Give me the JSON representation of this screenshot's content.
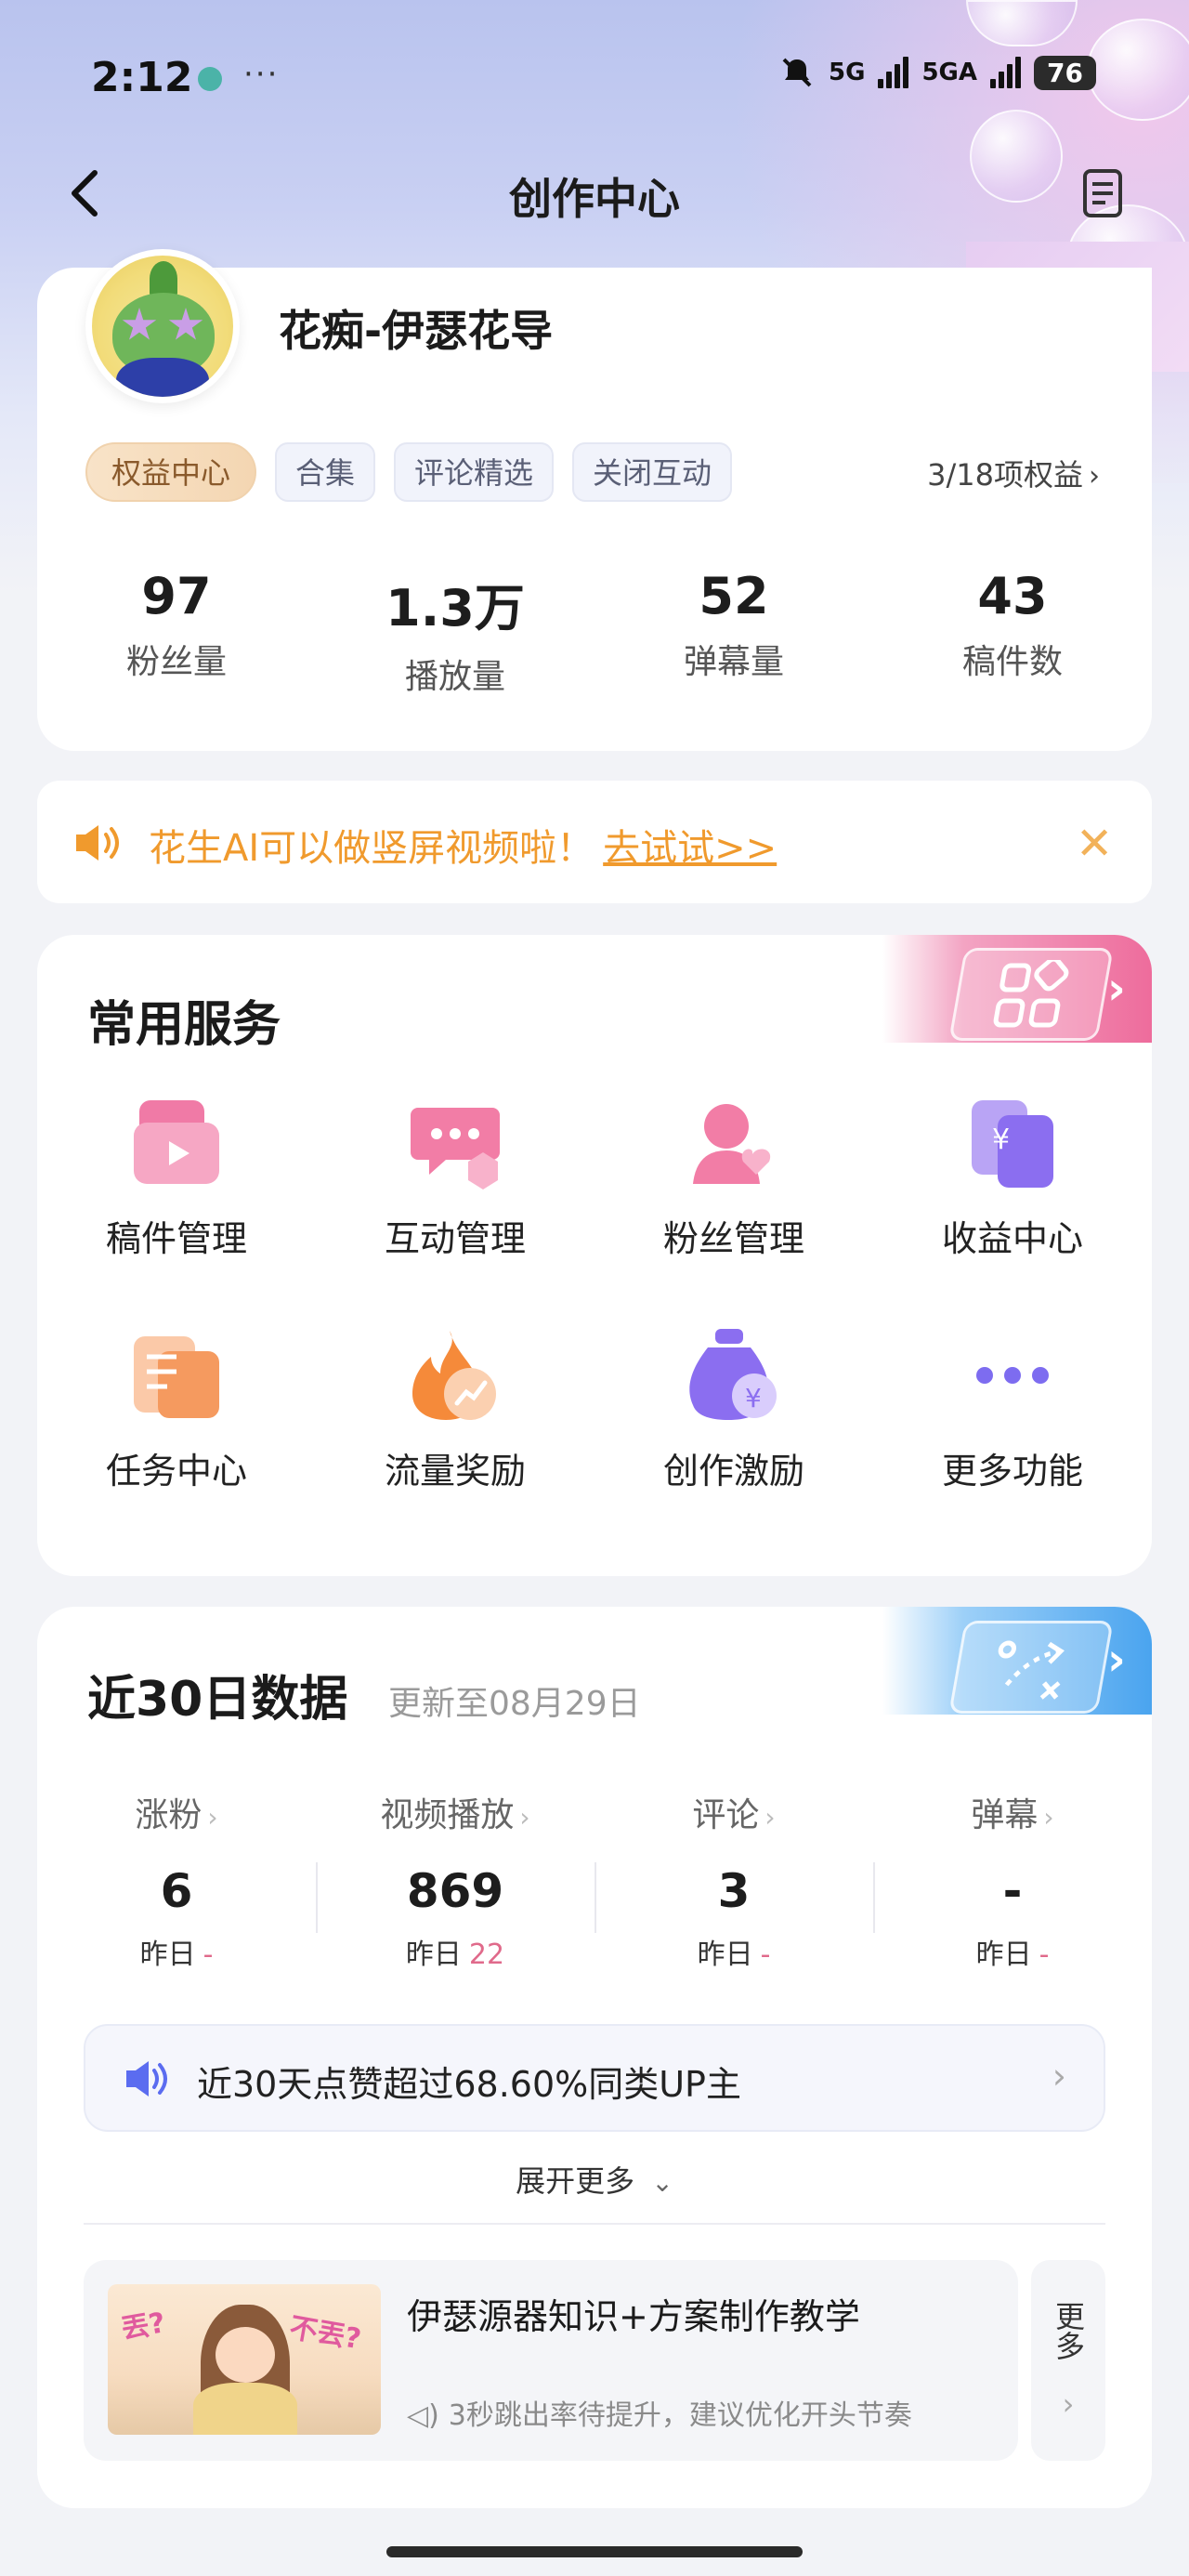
{
  "status_bar": {
    "time": "2:12",
    "dots": "···",
    "network_1": "5G",
    "network_2": "5GA",
    "battery": "76"
  },
  "nav": {
    "title": "创作中心"
  },
  "profile": {
    "username": "花痴-伊瑟花导",
    "tags": [
      "权益中心",
      "合集",
      "评论精选",
      "关闭互动"
    ],
    "rights": "3/18项权益",
    "stats": [
      {
        "value": "97",
        "label": "粉丝量"
      },
      {
        "value": "1.3万",
        "label": "播放量"
      },
      {
        "value": "52",
        "label": "弹幕量"
      },
      {
        "value": "43",
        "label": "稿件数"
      }
    ]
  },
  "notice": {
    "text": "花生AI可以做竖屏视频啦！",
    "link": "去试试>>",
    "close": "✕"
  },
  "services": {
    "title": "常用服务",
    "items": [
      {
        "label": "稿件管理",
        "icon": "manuscript-icon"
      },
      {
        "label": "互动管理",
        "icon": "chat-icon"
      },
      {
        "label": "粉丝管理",
        "icon": "fans-icon"
      },
      {
        "label": "收益中心",
        "icon": "income-icon"
      },
      {
        "label": "任务中心",
        "icon": "task-icon"
      },
      {
        "label": "流量奖励",
        "icon": "flame-icon"
      },
      {
        "label": "创作激励",
        "icon": "money-bag-icon"
      },
      {
        "label": "更多功能",
        "icon": "more-dots-icon"
      }
    ]
  },
  "data_section": {
    "title": "近30日数据",
    "subtitle": "更新至08月29日",
    "metrics": [
      {
        "label": "涨粉",
        "value": "6",
        "yday_label": "昨日",
        "yday_delta": "-"
      },
      {
        "label": "视频播放",
        "value": "869",
        "yday_label": "昨日",
        "yday_delta": "22"
      },
      {
        "label": "评论",
        "value": "3",
        "yday_label": "昨日",
        "yday_delta": "-"
      },
      {
        "label": "弹幕",
        "value": "-",
        "yday_label": "昨日",
        "yday_delta": "-"
      }
    ],
    "insight": "近30天点赞超过68.60%同类UP主",
    "expand": "展开更多",
    "tip": {
      "title": "伊瑟源器知识+方案制作教学",
      "note": "3秒跳出率待提升，建议优化开头节奏",
      "thumb_text_left": "丟?",
      "thumb_text_right": "不丟?"
    },
    "more": "更多"
  },
  "colors": {
    "accent_orange": "#f09a2d",
    "accent_pink": "#ee6c9c",
    "accent_blue": "#4aa4ef",
    "delta_pink": "#e06a8b"
  }
}
